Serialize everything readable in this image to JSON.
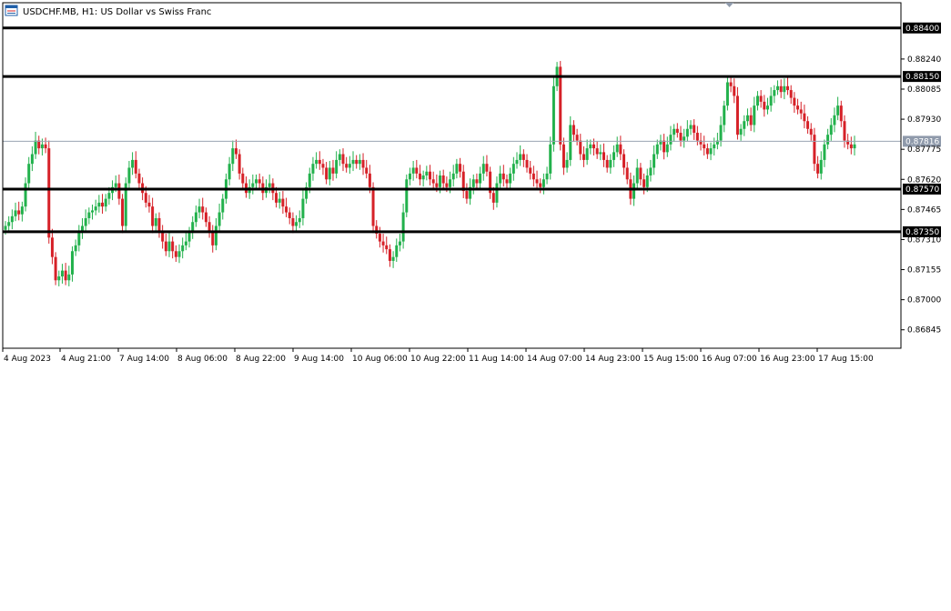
{
  "window": {
    "title": "USDCHF.MB, H1:  US Dollar vs Swiss Franc",
    "icon": "chart-window-icon"
  },
  "colors": {
    "bull": "#22b14c",
    "bear": "#d62128",
    "wick": "#000000",
    "level_line": "#000000",
    "price_line": "#9aa4b2",
    "price_label_bg": "#8f9aab",
    "level_label_bg": "#000000",
    "label_text_light": "#ffffff",
    "axis": "#000000"
  },
  "chart_data": {
    "type": "candlestick",
    "symbol": "USDCHF.MB",
    "timeframe": "H1",
    "description": "US Dollar vs Swiss Franc",
    "ylim": [
      0.8675,
      0.8853
    ],
    "y_ticks": [
      "0.88240",
      "0.88085",
      "0.87930",
      "0.87775",
      "0.87620",
      "0.87465",
      "0.87310",
      "0.87155",
      "0.87000",
      "0.86845"
    ],
    "x_ticks": [
      "4 Aug 2023",
      "4 Aug 21:00",
      "7 Aug 14:00",
      "8 Aug 06:00",
      "8 Aug 22:00",
      "9 Aug 14:00",
      "10 Aug 06:00",
      "10 Aug 22:00",
      "11 Aug 14:00",
      "14 Aug 07:00",
      "14 Aug 23:00",
      "15 Aug 15:00",
      "16 Aug 07:00",
      "16 Aug 23:00",
      "17 Aug 15:00"
    ],
    "levels": [
      {
        "value": 0.884,
        "label": "0.88400"
      },
      {
        "value": 0.8815,
        "label": "0.88150"
      },
      {
        "value": 0.8757,
        "label": "0.87570"
      },
      {
        "value": 0.8735,
        "label": "0.87350"
      }
    ],
    "current_price": {
      "value": 0.87816,
      "label": "0.87816"
    },
    "series": [
      {
        "c": [
          0.8738,
          0.874,
          0.8743,
          0.8746,
          0.8744,
          0.8748,
          0.876,
          0.877,
          0.8775,
          0.8782,
          0.8778,
          0.878,
          0.8778,
          0.8732,
          0.8722,
          0.871,
          0.8712,
          0.8715,
          0.871,
          0.8713,
          0.8725,
          0.8728,
          0.8735,
          0.8738,
          0.8742,
          0.8745,
          0.8746,
          0.8748,
          0.875,
          0.8748,
          0.8752,
          0.8755,
          0.8758,
          0.876,
          0.8752,
          0.8738,
          0.876,
          0.8768,
          0.8772,
          0.8765,
          0.876,
          0.8755,
          0.875,
          0.8748,
          0.8738,
          0.8742,
          0.8735,
          0.873,
          0.8725,
          0.873,
          0.8725,
          0.8722,
          0.8725,
          0.8728,
          0.873,
          0.8735,
          0.874,
          0.8745,
          0.8748,
          0.8745,
          0.874,
          0.8735,
          0.8728,
          0.8738,
          0.8745,
          0.8752,
          0.8762,
          0.877,
          0.8778,
          0.8775,
          0.8765,
          0.876,
          0.8755,
          0.8758,
          0.876,
          0.8762,
          0.876,
          0.8755,
          0.8758,
          0.876,
          0.8755,
          0.875,
          0.8752,
          0.8748,
          0.8745,
          0.8742,
          0.8738,
          0.874,
          0.8742,
          0.8752,
          0.8758,
          0.8765,
          0.877,
          0.8772,
          0.877,
          0.8768,
          0.8762,
          0.8768,
          0.8765,
          0.8772,
          0.8775,
          0.877,
          0.8768,
          0.877,
          0.8772,
          0.877,
          0.8772,
          0.8768,
          0.8765,
          0.8758,
          0.8738,
          0.8734,
          0.873,
          0.8728,
          0.8726,
          0.872,
          0.8722,
          0.8728,
          0.873,
          0.8745,
          0.8762,
          0.8765,
          0.8768,
          0.8765,
          0.8762,
          0.8764,
          0.8766,
          0.8762,
          0.876,
          0.8758,
          0.8764,
          0.876,
          0.8758,
          0.8762,
          0.8765,
          0.877,
          0.8766,
          0.8756,
          0.8752,
          0.8758,
          0.8762,
          0.876,
          0.8765,
          0.877,
          0.8766,
          0.8755,
          0.875,
          0.876,
          0.8765,
          0.8762,
          0.876,
          0.8765,
          0.877,
          0.8772,
          0.8775,
          0.8772,
          0.8768,
          0.8765,
          0.8762,
          0.876,
          0.8758,
          0.8762,
          0.8765,
          0.878,
          0.881,
          0.882,
          0.878,
          0.8768,
          0.8772,
          0.879,
          0.8785,
          0.8782,
          0.8775,
          0.8772,
          0.8778,
          0.878,
          0.8778,
          0.8775,
          0.8776,
          0.8772,
          0.8768,
          0.8772,
          0.8776,
          0.878,
          0.8775,
          0.8768,
          0.8762,
          0.8752,
          0.876,
          0.8768,
          0.8762,
          0.8758,
          0.8764,
          0.8768,
          0.8775,
          0.878,
          0.8782,
          0.8776,
          0.878,
          0.8785,
          0.8788,
          0.8786,
          0.8782,
          0.8784,
          0.8788,
          0.879,
          0.8786,
          0.8782,
          0.878,
          0.8778,
          0.8775,
          0.8778,
          0.878,
          0.8782,
          0.879,
          0.88,
          0.8812,
          0.881,
          0.8805,
          0.8785,
          0.8788,
          0.8792,
          0.8795,
          0.879,
          0.88,
          0.8805,
          0.8802,
          0.8798,
          0.88,
          0.8805,
          0.8808,
          0.881,
          0.8807,
          0.881,
          0.8808,
          0.8804,
          0.88,
          0.8798,
          0.8796,
          0.8792,
          0.8788,
          0.8785,
          0.877,
          0.8765,
          0.8772,
          0.878,
          0.8785,
          0.879,
          0.8795,
          0.88,
          0.8792,
          0.8782,
          0.878,
          0.8778,
          0.878
        ]
      }
    ]
  }
}
